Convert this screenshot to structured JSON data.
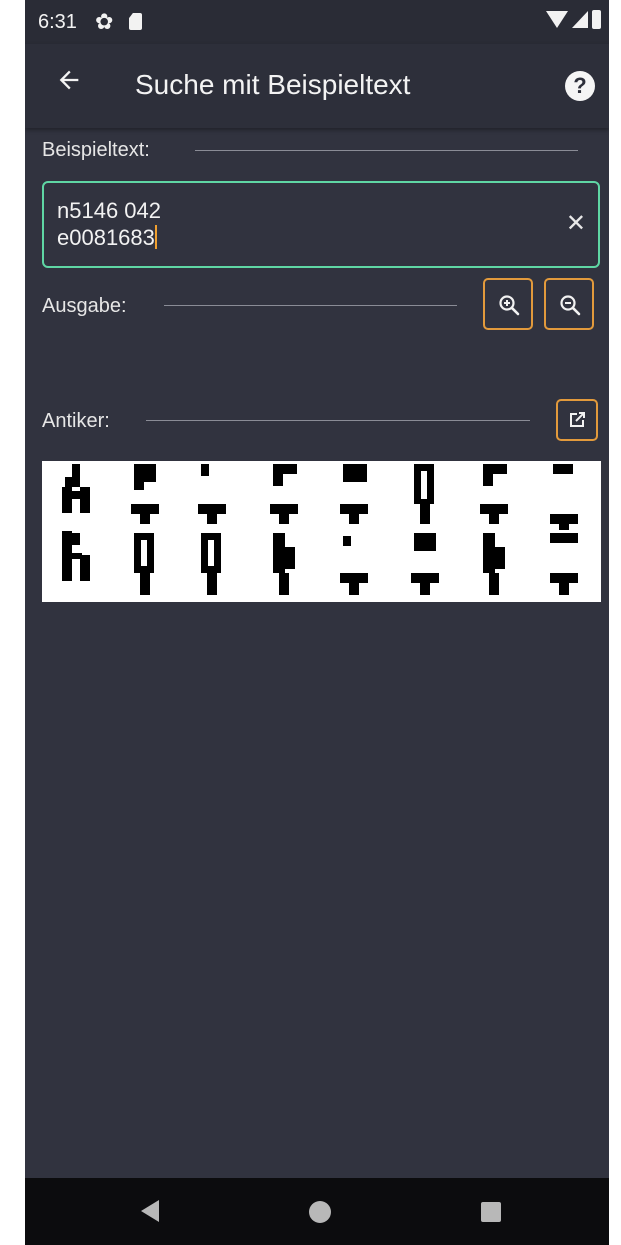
{
  "status_bar": {
    "time": "6:31",
    "icons": [
      "gear-icon",
      "sd-card-icon",
      "wifi-icon",
      "signal-icon",
      "battery-icon"
    ]
  },
  "toolbar": {
    "title": "Suche mit Beispieltext",
    "back_icon": "arrow-left-icon",
    "help_icon": "help-circle-icon",
    "help_glyph": "?"
  },
  "example_text": {
    "label": "Beispieltext:",
    "value": "n5146 042\ne0081683",
    "clear_glyph": "✕"
  },
  "output": {
    "label": "Ausgabe:",
    "zoom_in_icon": "zoom-in-icon",
    "zoom_out_icon": "zoom-out-icon"
  },
  "antiker": {
    "label": "Antiker:",
    "open_icon": "open-external-icon"
  },
  "colors": {
    "background": "#31333f",
    "toolbar": "#2d2f3a",
    "accent_green": "#5fd6a4",
    "accent_orange": "#e29a3c"
  },
  "nav_bar": {
    "icons": [
      "nav-back-icon",
      "nav-home-icon",
      "nav-recent-icon"
    ]
  }
}
